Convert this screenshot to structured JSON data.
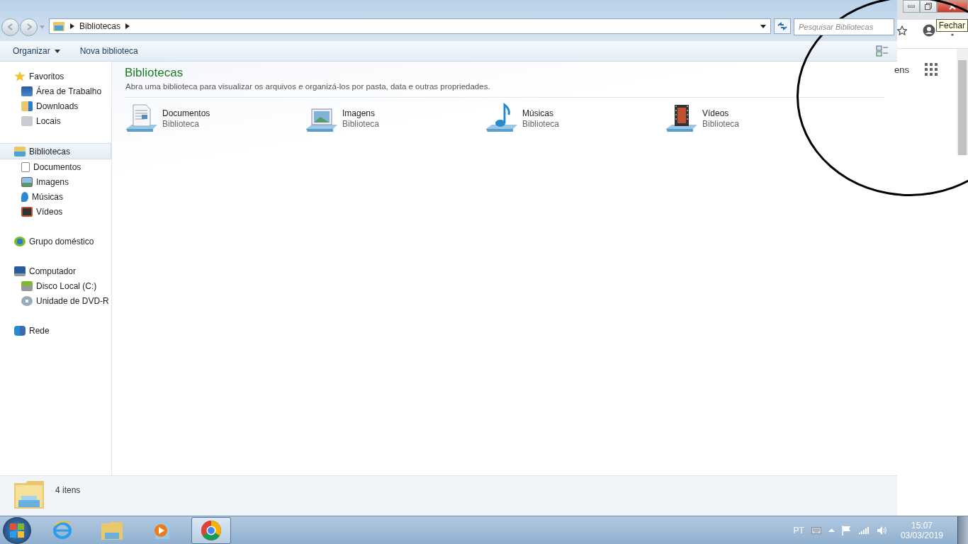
{
  "address_bar": {
    "crumbs": [
      "Bibliotecas"
    ]
  },
  "search": {
    "placeholder": "Pesquisar Bibliotecas"
  },
  "toolbar": {
    "buttons": [
      {
        "label": "Organizar",
        "dropdown": true
      },
      {
        "label": "Nova biblioteca",
        "dropdown": false
      }
    ]
  },
  "sidebar": {
    "groups": [
      {
        "label": "Favoritos",
        "selected": false,
        "children": [
          {
            "label": "Área de Trabalho",
            "selected": false
          },
          {
            "label": "Downloads",
            "selected": false
          },
          {
            "label": "Locais",
            "selected": false
          }
        ]
      },
      {
        "label": "Bibliotecas",
        "selected": true,
        "children": [
          {
            "label": "Documentos",
            "selected": false
          },
          {
            "label": "Imagens",
            "selected": false
          },
          {
            "label": "Músicas",
            "selected": false
          },
          {
            "label": "Vídeos",
            "selected": false
          }
        ]
      },
      {
        "label": "Grupo doméstico",
        "selected": false
      },
      {
        "label": "Computador",
        "selected": false,
        "children": [
          {
            "label": "Disco Local (C:)",
            "selected": false
          },
          {
            "label": "Unidade de DVD-R",
            "selected": false
          }
        ]
      },
      {
        "label": "Rede",
        "selected": false
      }
    ]
  },
  "content": {
    "title": "Bibliotecas",
    "description": "Abra uma biblioteca para visualizar os arquivos e organizá-los por pasta, data e outras propriedades.",
    "libraries": [
      {
        "name": "Documentos",
        "type": "Biblioteca"
      },
      {
        "name": "Imagens",
        "type": "Biblioteca"
      },
      {
        "name": "Músicas",
        "type": "Biblioteca"
      },
      {
        "name": "Vídeos",
        "type": "Biblioteca"
      }
    ]
  },
  "details_pane": {
    "count": "4 itens"
  },
  "browser_behind": {
    "text": "ens",
    "tooltip": "Fechar"
  },
  "taskbar": {
    "apps": [
      {
        "selected": false
      },
      {
        "selected": false
      },
      {
        "selected": false
      },
      {
        "selected": true
      }
    ],
    "language": "PT",
    "time": "15:07",
    "date": "03/03/2019"
  }
}
